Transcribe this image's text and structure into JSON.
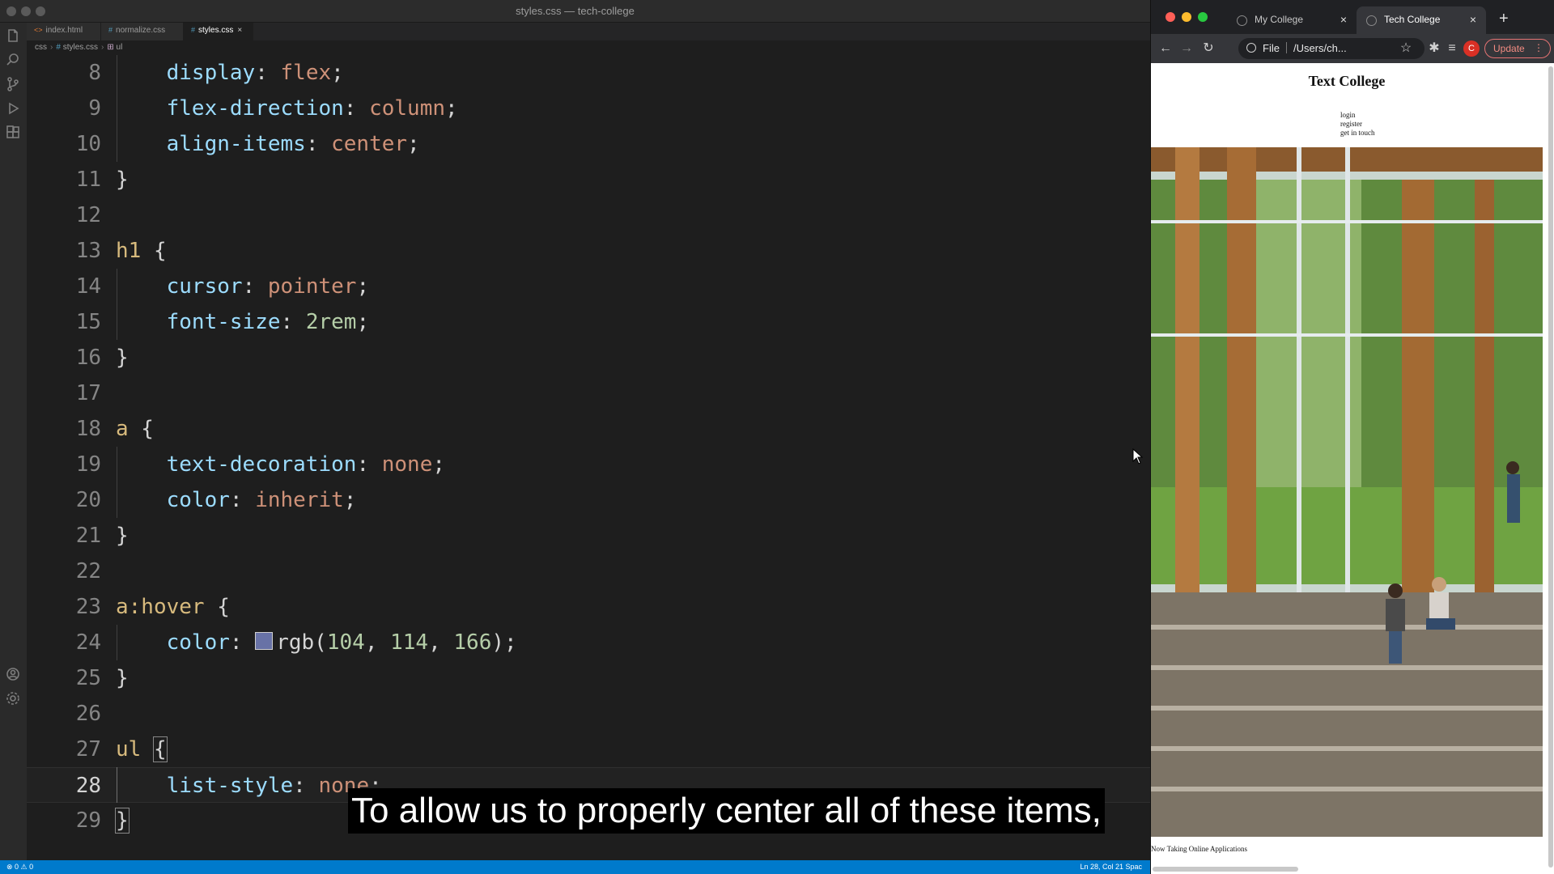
{
  "vscode": {
    "window_title": "styles.css — tech-college",
    "tabs": [
      {
        "icon": "<>",
        "label": "index.html",
        "active": false
      },
      {
        "icon": "#",
        "label": "normalize.css",
        "active": false
      },
      {
        "icon": "#",
        "label": "styles.css",
        "active": true
      }
    ],
    "breadcrumb": [
      "css",
      "styles.css",
      "ul"
    ],
    "code_lines": [
      {
        "n": "8",
        "text": "    display: flex;"
      },
      {
        "n": "9",
        "text": "    flex-direction: column;"
      },
      {
        "n": "10",
        "text": "    align-items: center;"
      },
      {
        "n": "11",
        "text": "}"
      },
      {
        "n": "12",
        "text": ""
      },
      {
        "n": "13",
        "text": "h1 {"
      },
      {
        "n": "14",
        "text": "    cursor: pointer;"
      },
      {
        "n": "15",
        "text": "    font-size: 2rem;"
      },
      {
        "n": "16",
        "text": "}"
      },
      {
        "n": "17",
        "text": ""
      },
      {
        "n": "18",
        "text": "a {"
      },
      {
        "n": "19",
        "text": "    text-decoration: none;"
      },
      {
        "n": "20",
        "text": "    color: inherit;"
      },
      {
        "n": "21",
        "text": "}"
      },
      {
        "n": "22",
        "text": ""
      },
      {
        "n": "23",
        "text": "a:hover {"
      },
      {
        "n": "24",
        "text": "    color: rgb(104, 114, 166);"
      },
      {
        "n": "25",
        "text": "}"
      },
      {
        "n": "26",
        "text": ""
      },
      {
        "n": "27",
        "text": "ul {"
      },
      {
        "n": "28",
        "text": "    list-style: none;"
      },
      {
        "n": "29",
        "text": "}"
      }
    ],
    "current_line": "28",
    "swatch_color": "#6872a6",
    "status_left": "⊗ 0 ⚠ 0",
    "status_right": "Ln 28, Col 21   Spac"
  },
  "browser": {
    "tabs": [
      {
        "label": "My College",
        "active": false
      },
      {
        "label": "Tech College",
        "active": true
      }
    ],
    "address_scheme": "File",
    "address_path": "/Users/ch...",
    "profile_initial": "C",
    "update_label": "Update",
    "page": {
      "title": "Text College",
      "nav": [
        "login",
        "register",
        "get in touch"
      ],
      "footer": "Now Taking Online Applications"
    }
  },
  "subtitle": "To allow us to properly center all of these items,",
  "colors": {
    "selector": "#d7ba7d",
    "property": "#9cdcfe",
    "value": "#ce9178",
    "number": "#b5cea8",
    "statusbar": "#007acc"
  }
}
